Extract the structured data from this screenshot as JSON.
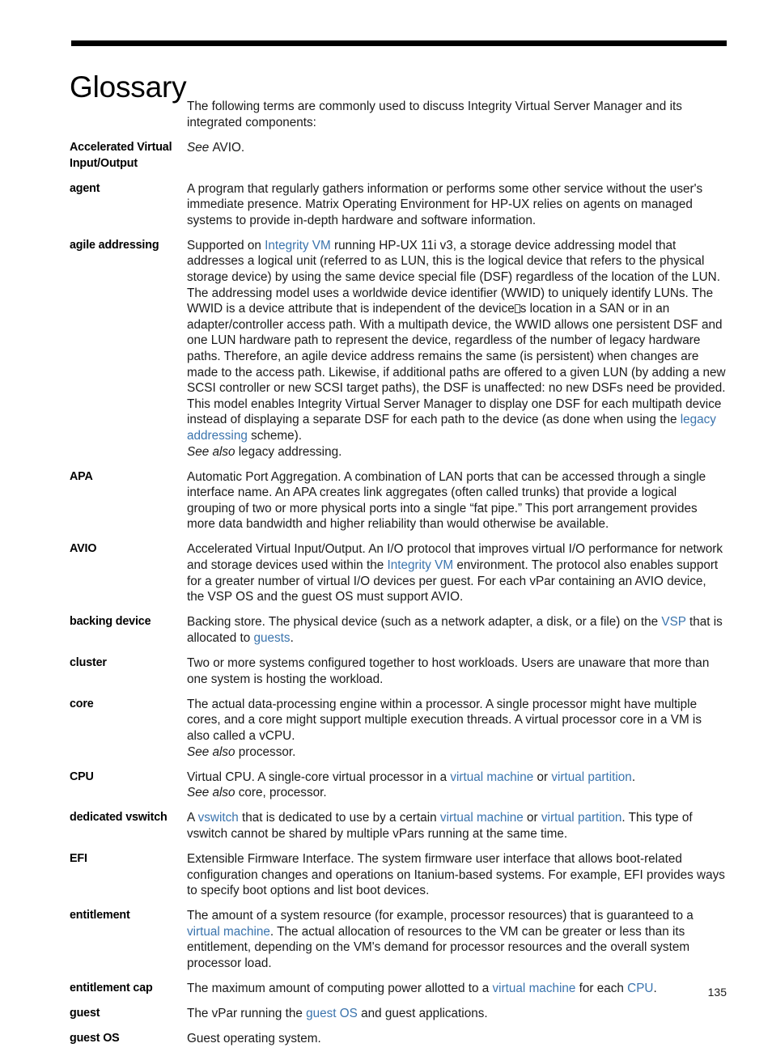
{
  "page": {
    "title": "Glossary",
    "page_number": "135",
    "link_color": "#3b74ad",
    "rule_color": "#000000"
  },
  "intro": "The following terms are commonly used to discuss Integrity Virtual Server Manager and its integrated components:",
  "entries": [
    {
      "term": "Accelerated Virtual Input/Output",
      "paragraphs": [
        [
          {
            "t": "See ",
            "style": "italic"
          },
          {
            "t": "AVIO."
          }
        ]
      ]
    },
    {
      "term": "agent",
      "paragraphs": [
        [
          {
            "t": "A program that regularly gathers information or performs some other service without the user's immediate presence. Matrix Operating Environment for HP-UX relies on agents on managed systems to provide in-depth hardware and software information."
          }
        ]
      ]
    },
    {
      "term": "agile addressing",
      "paragraphs": [
        [
          {
            "t": "Supported on "
          },
          {
            "t": "Integrity VM",
            "style": "link"
          },
          {
            "t": " running HP-UX 11i v3, a storage device addressing model that addresses a logical unit (referred to as LUN, this is the logical device that refers to the physical storage device) by using the same device special file (DSF) regardless of the location of the LUN. The addressing model uses a worldwide device identifier (WWID) to uniquely identify LUNs. The WWID is a device attribute that is independent of the device"
          },
          {
            "t": "",
            "style": "missing-glyph"
          },
          {
            "t": "s location in a SAN or in an adapter/controller access path. With a multipath device, the WWID allows one persistent DSF and one LUN hardware path to represent the device, regardless of the number of legacy hardware paths. Therefore, an agile device address remains the same (is persistent) when changes are made to the access path. Likewise, if additional paths are offered to a given LUN (by adding a new SCSI controller or new SCSI target paths), the DSF is unaffected: no new DSFs need be provided. This model enables Integrity Virtual Server Manager to display one DSF for each multipath device instead of displaying a separate DSF for each path to the device (as done when using the "
          },
          {
            "t": "legacy addressing",
            "style": "link"
          },
          {
            "t": " scheme)."
          }
        ],
        [
          {
            "t": "See also ",
            "style": "italic"
          },
          {
            "t": "legacy addressing."
          }
        ]
      ]
    },
    {
      "term": "APA",
      "paragraphs": [
        [
          {
            "t": "Automatic Port Aggregation. A combination of LAN ports that can be accessed through a single interface name. An APA creates link aggregates (often called trunks) that provide a logical grouping of two or more physical ports into a single “fat pipe.” This port arrangement provides more data bandwidth and higher reliability than would otherwise be available."
          }
        ]
      ]
    },
    {
      "term": "AVIO",
      "paragraphs": [
        [
          {
            "t": "Accelerated Virtual Input/Output. An I/O protocol that improves virtual I/O performance for network and storage devices used within the "
          },
          {
            "t": "Integrity VM",
            "style": "link"
          },
          {
            "t": " environment. The protocol also enables support for a greater number of virtual I/O devices per guest. For each vPar containing an AVIO device, the VSP OS and the guest OS must support AVIO."
          }
        ]
      ]
    },
    {
      "term": "backing device",
      "paragraphs": [
        [
          {
            "t": "Backing store. The physical device (such as a network adapter, a disk, or a file) on the "
          },
          {
            "t": "VSP",
            "style": "link"
          },
          {
            "t": " that is allocated to "
          },
          {
            "t": "guests",
            "style": "link"
          },
          {
            "t": "."
          }
        ]
      ]
    },
    {
      "term": "cluster",
      "paragraphs": [
        [
          {
            "t": "Two or more systems configured together to host workloads. Users are unaware that more than one system is hosting the workload."
          }
        ]
      ]
    },
    {
      "term": "core",
      "paragraphs": [
        [
          {
            "t": "The actual data-processing engine within a processor. A single processor might have multiple cores, and a core might support multiple execution threads. A virtual processor core in a VM is also called a vCPU."
          }
        ],
        [
          {
            "t": "See also ",
            "style": "italic"
          },
          {
            "t": "processor."
          }
        ]
      ]
    },
    {
      "term": "CPU",
      "paragraphs": [
        [
          {
            "t": "Virtual CPU. A single-core virtual processor in a "
          },
          {
            "t": "virtual machine",
            "style": "link"
          },
          {
            "t": " or "
          },
          {
            "t": "virtual partition",
            "style": "link"
          },
          {
            "t": "."
          }
        ],
        [
          {
            "t": "See also ",
            "style": "italic"
          },
          {
            "t": "core, processor."
          }
        ]
      ]
    },
    {
      "term": "dedicated vswitch",
      "paragraphs": [
        [
          {
            "t": "A "
          },
          {
            "t": "vswitch",
            "style": "link"
          },
          {
            "t": " that is dedicated to use by a certain "
          },
          {
            "t": "virtual machine",
            "style": "link"
          },
          {
            "t": " or "
          },
          {
            "t": "virtual partition",
            "style": "link"
          },
          {
            "t": ". This type of vswitch cannot be shared by multiple vPars running at the same time."
          }
        ]
      ]
    },
    {
      "term": "EFI",
      "paragraphs": [
        [
          {
            "t": "Extensible Firmware Interface. The system firmware user interface that allows boot-related configuration changes and operations on Itanium-based systems. For example, EFI provides ways to specify boot options and list boot devices."
          }
        ]
      ]
    },
    {
      "term": "entitlement",
      "paragraphs": [
        [
          {
            "t": "The amount of a system resource (for example, processor resources) that is guaranteed to a "
          },
          {
            "t": "virtual machine",
            "style": "link"
          },
          {
            "t": ". The actual allocation of resources to the VM can be greater or less than its entitlement, depending on the VM's demand for processor resources and the overall system processor load."
          }
        ]
      ]
    },
    {
      "term": "entitlement cap",
      "paragraphs": [
        [
          {
            "t": "The maximum amount of computing power allotted to a "
          },
          {
            "t": "virtual machine",
            "style": "link"
          },
          {
            "t": " for each "
          },
          {
            "t": "CPU",
            "style": "link"
          },
          {
            "t": "."
          }
        ]
      ]
    },
    {
      "term": "guest",
      "paragraphs": [
        [
          {
            "t": "The vPar running the "
          },
          {
            "t": "guest OS",
            "style": "link"
          },
          {
            "t": " and guest applications."
          }
        ]
      ]
    },
    {
      "term": "guest OS",
      "paragraphs": [
        [
          {
            "t": "Guest operating system."
          }
        ]
      ]
    }
  ]
}
